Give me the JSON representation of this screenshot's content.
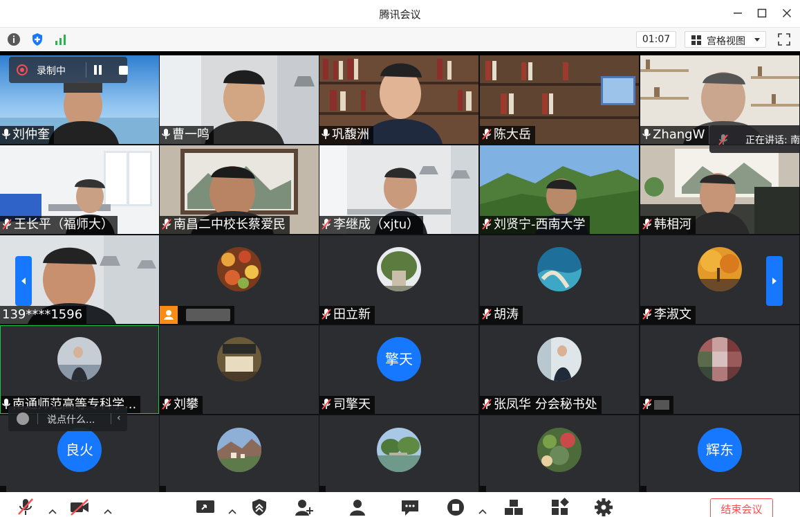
{
  "window": {
    "title": "腾讯会议"
  },
  "toolbar": {
    "timer": "01:07",
    "view_label": "宫格视图"
  },
  "recording": {
    "label": "录制中"
  },
  "speaking": {
    "label": "正在讲话: 南"
  },
  "chat": {
    "placeholder": "说点什么..."
  },
  "participants": [
    {
      "name": "刘仲奎",
      "muted": false
    },
    {
      "name": "曹一鸣",
      "muted": false
    },
    {
      "name": "巩馥洲",
      "muted": false
    },
    {
      "name": "陈大岳",
      "muted": true
    },
    {
      "name": "ZhangW",
      "muted": false
    },
    {
      "name": "王长平（福师大）",
      "muted": true
    },
    {
      "name": "南昌二中校长蔡爱民",
      "muted": true
    },
    {
      "name": "李继成（xjtu）",
      "muted": true
    },
    {
      "name": "刘贤宁-西南大学",
      "muted": true
    },
    {
      "name": "韩相河",
      "muted": true
    },
    {
      "name": "139****1596",
      "muted": false
    },
    {
      "name": "",
      "muted": false
    },
    {
      "name": "田立新",
      "muted": true
    },
    {
      "name": "胡涛",
      "muted": true
    },
    {
      "name": "李淑文",
      "muted": true
    },
    {
      "name": "南通师范高等专科学...",
      "muted": false
    },
    {
      "name": "刘攀",
      "muted": true
    },
    {
      "name": "司擎天",
      "muted": true,
      "avatar_text": "擎天"
    },
    {
      "name": "张凤华 分会秘书处",
      "muted": true
    },
    {
      "name": "",
      "muted": true
    },
    {
      "name": "",
      "muted": false,
      "avatar_text": "良火"
    },
    {
      "name": "",
      "muted": false
    },
    {
      "name": "",
      "muted": false
    },
    {
      "name": "",
      "muted": false
    },
    {
      "name": "",
      "muted": false,
      "avatar_text": "辉东"
    }
  ],
  "bottom": {
    "end_label": "结束会议"
  },
  "colors": {
    "accent": "#1677ff",
    "end": "#ff4d4f",
    "active": "#27c24c"
  }
}
